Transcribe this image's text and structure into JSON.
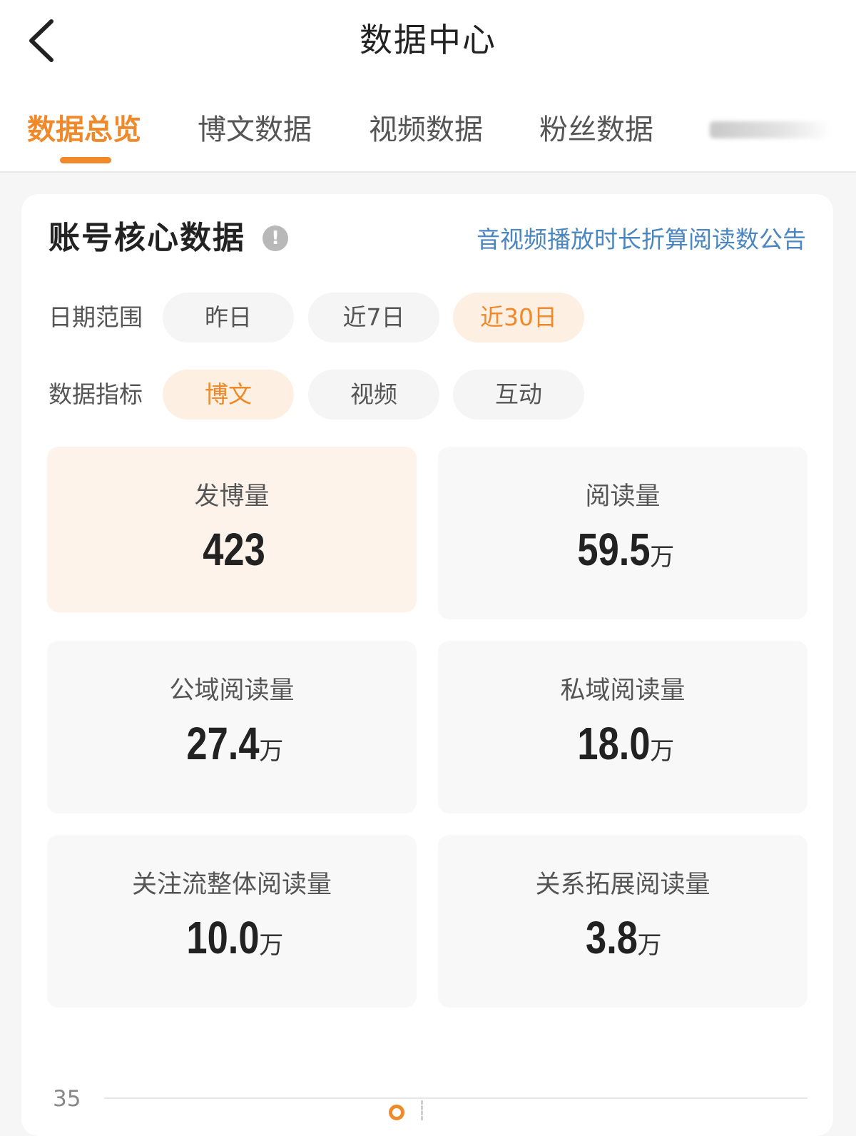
{
  "header": {
    "title": "数据中心",
    "back_icon": "chevron-left-icon"
  },
  "tabs": [
    {
      "label": "数据总览",
      "active": true
    },
    {
      "label": "博文数据",
      "active": false
    },
    {
      "label": "视频数据",
      "active": false
    },
    {
      "label": "粉丝数据",
      "active": false
    }
  ],
  "core": {
    "title": "账号核心数据",
    "info_icon": "info-icon",
    "notice_link": "音视频播放时长折算阅读数公告",
    "date_range": {
      "label": "日期范围",
      "options": [
        "昨日",
        "近7日",
        "近30日"
      ],
      "selected": "近30日"
    },
    "metric_type": {
      "label": "数据指标",
      "options": [
        "博文",
        "视频",
        "互动"
      ],
      "selected": "博文"
    },
    "metrics": [
      {
        "label": "发博量",
        "value": "423",
        "unit": ""
      },
      {
        "label": "阅读量",
        "value": "59.5",
        "unit": "万"
      },
      {
        "label": "公域阅读量",
        "value": "27.4",
        "unit": "万"
      },
      {
        "label": "私域阅读量",
        "value": "18.0",
        "unit": "万"
      },
      {
        "label": "关注流整体阅读量",
        "value": "10.0",
        "unit": "万"
      },
      {
        "label": "关系拓展阅读量",
        "value": "3.8",
        "unit": "万"
      }
    ]
  },
  "chart": {
    "y_tick_top": "35"
  },
  "colors": {
    "accent": "#f0892a",
    "link": "#4a86c0",
    "page_bg": "#f6f6f6"
  }
}
